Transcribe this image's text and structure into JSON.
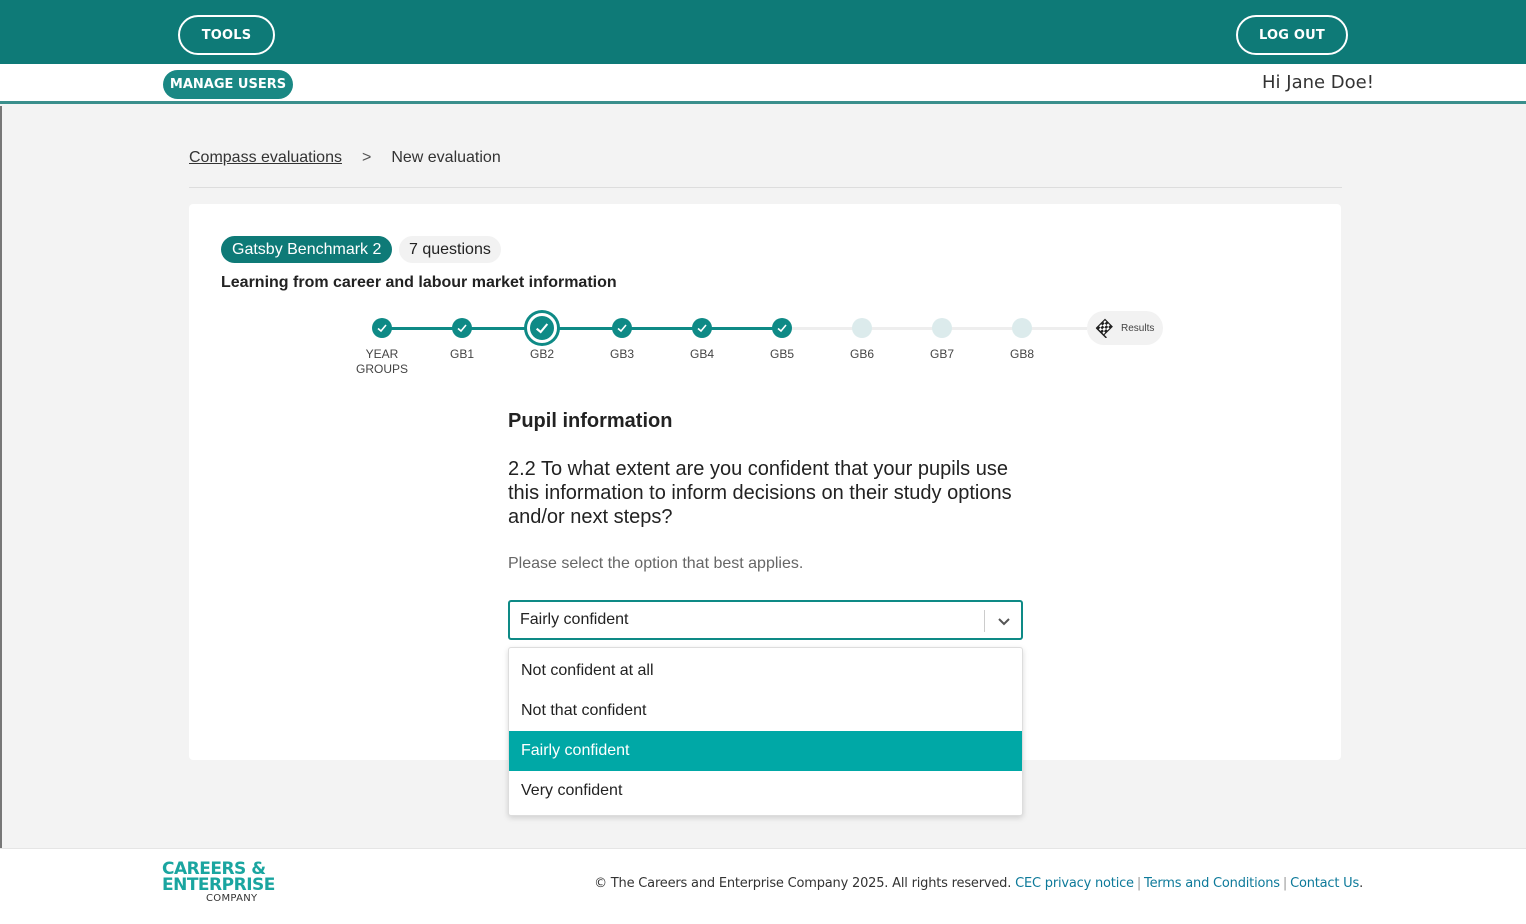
{
  "header": {
    "tools_label": "TOOLS",
    "logout_label": "LOG OUT",
    "manage_users_label": "MANAGE USERS",
    "greeting": "Hi Jane Doe!"
  },
  "breadcrumb": {
    "parent": "Compass evaluations",
    "separator": ">",
    "current": "New evaluation"
  },
  "card": {
    "badge": "Gatsby Benchmark 2",
    "question_count": "7 questions",
    "subtitle": "Learning from career and labour market information"
  },
  "stepper": {
    "steps": [
      {
        "label_line1": "YEAR",
        "label_line2": "GROUPS",
        "state": "done"
      },
      {
        "label_line1": "GB1",
        "label_line2": "",
        "state": "done"
      },
      {
        "label_line1": "GB2",
        "label_line2": "",
        "state": "current"
      },
      {
        "label_line1": "GB3",
        "label_line2": "",
        "state": "done"
      },
      {
        "label_line1": "GB4",
        "label_line2": "",
        "state": "done"
      },
      {
        "label_line1": "GB5",
        "label_line2": "",
        "state": "done"
      },
      {
        "label_line1": "GB6",
        "label_line2": "",
        "state": "todo"
      },
      {
        "label_line1": "GB7",
        "label_line2": "",
        "state": "todo"
      },
      {
        "label_line1": "GB8",
        "label_line2": "",
        "state": "todo"
      }
    ],
    "results_label": "Results"
  },
  "question": {
    "section_title": "Pupil information",
    "text": "2.2 To what extent are you confident that your pupils use this information to inform decisions on their study options and/or next steps?",
    "hint": "Please select the option that best applies."
  },
  "select": {
    "value": "Fairly confident",
    "options": [
      "Not confident at all",
      "Not that confident",
      "Fairly confident",
      "Very confident"
    ],
    "selected_index": 2
  },
  "footer": {
    "logo_line1": "CAREERS &",
    "logo_line2": "ENTERPRISE",
    "logo_line3": "COMPANY",
    "copyright": "© The Careers and Enterprise Company 2025. All rights reserved.",
    "privacy_link": "CEC privacy notice",
    "terms_link": "Terms and Conditions",
    "contact_link": "Contact Us",
    "separator": "|",
    "end_punct": "."
  },
  "colors": {
    "brand_teal": "#0e7a77",
    "accent_teal": "#0e8a86",
    "selected_option": "#00a8a6",
    "link": "#0e7a9a"
  }
}
